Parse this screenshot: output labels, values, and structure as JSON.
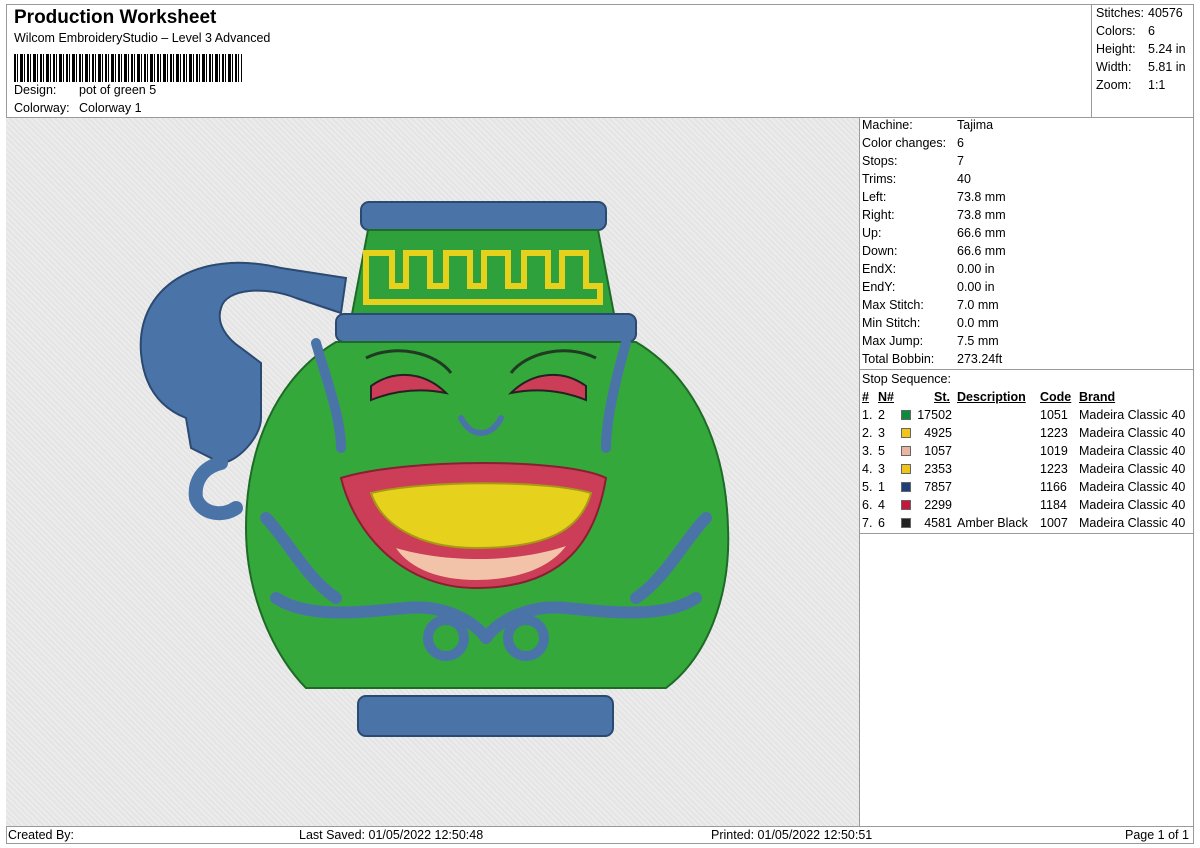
{
  "header": {
    "title": "Production Worksheet",
    "subtitle": "Wilcom EmbroideryStudio – Level 3 Advanced",
    "design_label": "Design:",
    "design_value": "pot of green 5",
    "colorway_label": "Colorway:",
    "colorway_value": "Colorway 1"
  },
  "summary": {
    "stitches_label": "Stitches:",
    "stitches": "40576",
    "colors_label": "Colors:",
    "colors": "6",
    "height_label": "Height:",
    "height": "5.24 in",
    "width_label": "Width:",
    "width": "5.81 in",
    "zoom_label": "Zoom:",
    "zoom": "1:1"
  },
  "info": [
    {
      "label": "Machine:",
      "value": "Tajima"
    },
    {
      "label": "Color changes:",
      "value": "6"
    },
    {
      "label": "Stops:",
      "value": "7"
    },
    {
      "label": "Trims:",
      "value": "40"
    },
    {
      "label": "Left:",
      "value": "73.8 mm"
    },
    {
      "label": "Right:",
      "value": "73.8 mm"
    },
    {
      "label": "Up:",
      "value": "66.6 mm"
    },
    {
      "label": "Down:",
      "value": "66.6 mm"
    },
    {
      "label": "EndX:",
      "value": "0.00 in"
    },
    {
      "label": "EndY:",
      "value": "0.00 in"
    },
    {
      "label": "Max Stitch:",
      "value": "7.0 mm"
    },
    {
      "label": "Min Stitch:",
      "value": "0.0 mm"
    },
    {
      "label": "Max Jump:",
      "value": "7.5 mm"
    },
    {
      "label": "Total Bobbin:",
      "value": "273.24ft"
    }
  ],
  "stops": {
    "title": "Stop Sequence:",
    "columns": {
      "num": "#",
      "n": "N#",
      "st": "St.",
      "desc": "Description",
      "code": "Code",
      "brand": "Brand"
    },
    "rows": [
      {
        "num": "1.",
        "n": "2",
        "color": "#0d8a3c",
        "st": "17502",
        "desc": "",
        "code": "1051",
        "brand": "Madeira Classic 40"
      },
      {
        "num": "2.",
        "n": "3",
        "color": "#f0c419",
        "st": "4925",
        "desc": "",
        "code": "1223",
        "brand": "Madeira Classic 40"
      },
      {
        "num": "3.",
        "n": "5",
        "color": "#eab4a2",
        "st": "1057",
        "desc": "",
        "code": "1019",
        "brand": "Madeira Classic 40"
      },
      {
        "num": "4.",
        "n": "3",
        "color": "#f0c419",
        "st": "2353",
        "desc": "",
        "code": "1223",
        "brand": "Madeira Classic 40"
      },
      {
        "num": "5.",
        "n": "1",
        "color": "#1d3f7a",
        "st": "7857",
        "desc": "",
        "code": "1166",
        "brand": "Madeira Classic 40"
      },
      {
        "num": "6.",
        "n": "4",
        "color": "#c4173e",
        "st": "2299",
        "desc": "",
        "code": "1184",
        "brand": "Madeira Classic 40"
      },
      {
        "num": "7.",
        "n": "6",
        "color": "#222222",
        "st": "4581",
        "desc": "Amber Black",
        "code": "1007",
        "brand": "Madeira Classic 40"
      }
    ]
  },
  "footer": {
    "created_by": "Created By:",
    "last_saved": "Last Saved: 01/05/2022 12:50:48",
    "printed": "Printed: 01/05/2022 12:50:51",
    "page": "Page 1 of 1"
  },
  "colors": {
    "pot_green": "#35a83c",
    "trim_blue": "#4a74a8",
    "gold": "#e6d21c",
    "lip_red": "#cc3d57"
  }
}
